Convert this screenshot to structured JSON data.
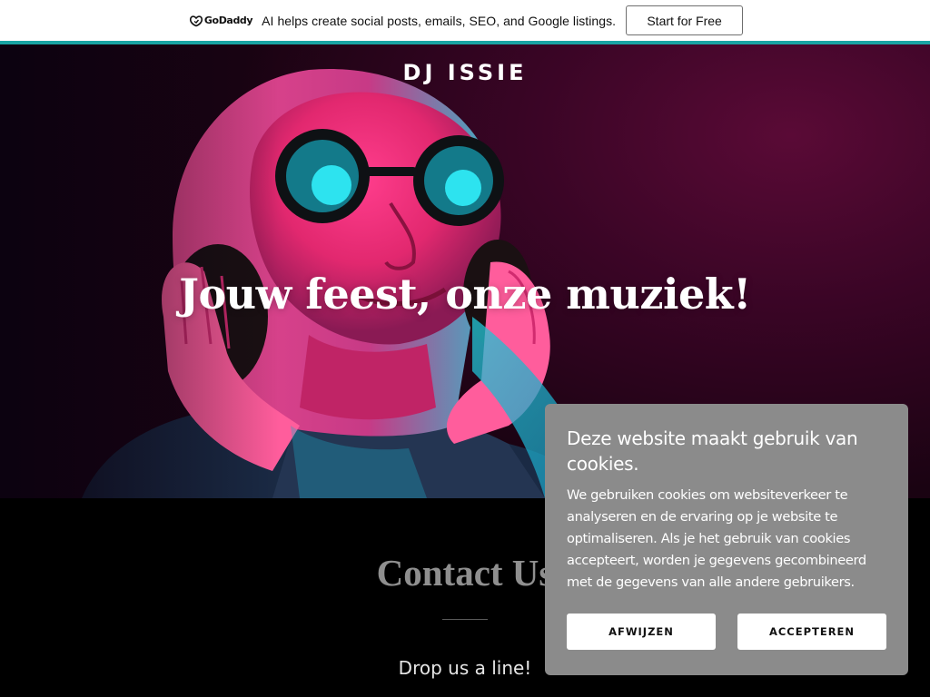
{
  "promo": {
    "logo_text": "GoDaddy",
    "message": "AI helps create social posts, emails, SEO, and Google listings.",
    "cta_label": "Start for Free",
    "accent_color": "#19a5a4"
  },
  "header": {
    "site_title": "DJ ISSIE"
  },
  "hero": {
    "heading": "Jouw feest, onze muziek!"
  },
  "contact": {
    "title": "Contact Us",
    "subtitle": "Drop us a line!"
  },
  "cookie_banner": {
    "title": "Deze website maakt gebruik van cookies.",
    "body": "We gebruiken cookies om websiteverkeer te analyseren en de ervaring op je website te optimaliseren. Als je het gebruik van cookies accepteert, worden je gegevens gecombineerd met de gegevens van alle andere gebruikers.",
    "decline_label": "AFWIJZEN",
    "accept_label": "ACCEPTEREN"
  }
}
